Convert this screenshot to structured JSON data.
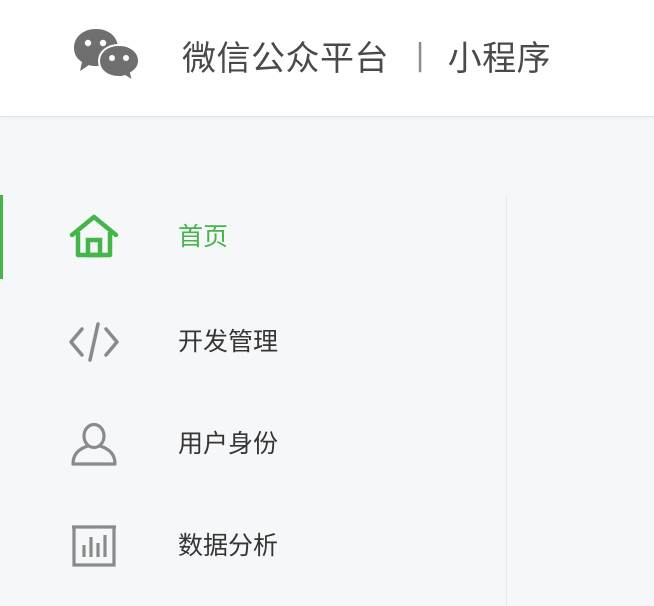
{
  "header": {
    "title": "微信公众平台",
    "separator": "|",
    "subtitle": "小程序",
    "logo_icon": "wechat-logo-icon"
  },
  "colors": {
    "accent": "#44b549",
    "text": "#353535",
    "icon_gray": "#8a8a8a",
    "background": "#f6f7f9"
  },
  "sidebar": {
    "items": [
      {
        "label": "首页",
        "icon": "home-icon",
        "active": true
      },
      {
        "label": "开发管理",
        "icon": "code-icon",
        "active": false
      },
      {
        "label": "用户身份",
        "icon": "user-icon",
        "active": false
      },
      {
        "label": "数据分析",
        "icon": "bar-chart-icon",
        "active": false
      }
    ]
  }
}
